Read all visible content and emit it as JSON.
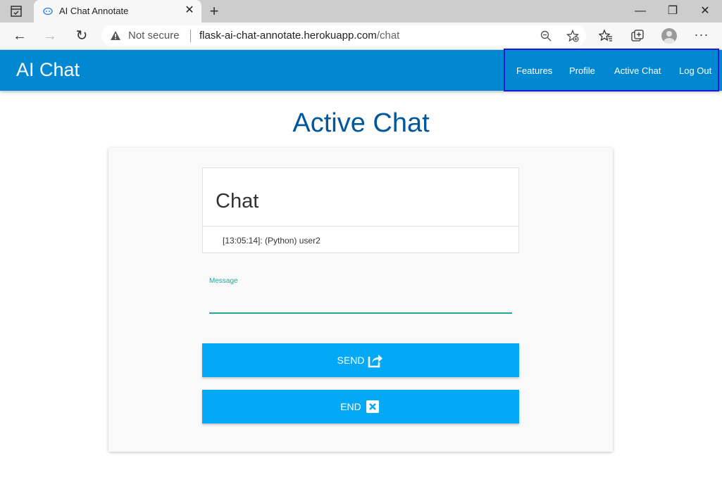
{
  "browser": {
    "tab_title": "AI Chat Annotate",
    "tab_close": "✕",
    "new_tab": "+",
    "not_secure": "Not secure",
    "url_host": "flask-ai-chat-annotate.herokuapp.com",
    "url_path": "/chat",
    "minimize": "—",
    "maximize": "❐",
    "close": "✕",
    "more": "···"
  },
  "header": {
    "brand": "AI Chat",
    "nav": [
      "Features",
      "Profile",
      "Active Chat",
      "Log Out"
    ]
  },
  "page": {
    "title": "Active Chat"
  },
  "chat": {
    "title": "Chat",
    "messages": [
      "[13:05:14]: (Python) user2"
    ]
  },
  "form": {
    "message_label": "Message",
    "message_value": "",
    "send_label": "Send",
    "end_label": "End"
  },
  "colors": {
    "header_bg": "#0288d1",
    "title": "#01579b",
    "button": "#03a9f4",
    "input_accent": "#26a69a",
    "highlight_box": "#1a1ad6"
  }
}
